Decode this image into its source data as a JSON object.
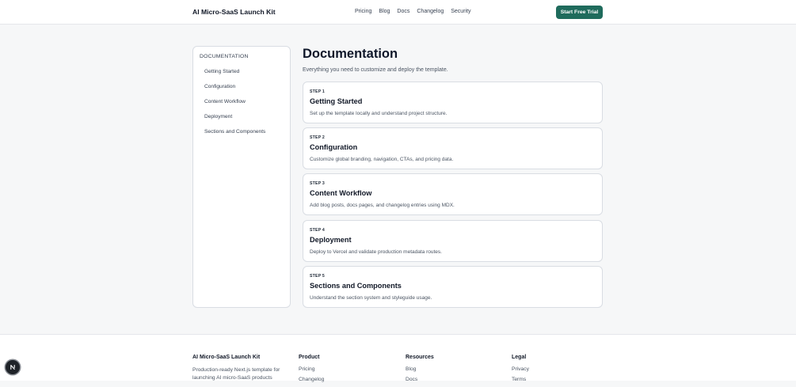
{
  "header": {
    "brand": "AI Micro-SaaS Launch Kit",
    "nav": [
      "Pricing",
      "Blog",
      "Docs",
      "Changelog",
      "Security"
    ],
    "cta": "Start Free Trial"
  },
  "sidebar": {
    "title": "DOCUMENTATION",
    "items": [
      "Getting Started",
      "Configuration",
      "Content Workflow",
      "Deployment",
      "Sections and Components"
    ]
  },
  "main": {
    "title": "Documentation",
    "subtitle": "Everything you need to customize and deploy the template.",
    "cards": [
      {
        "step": "STEP 1",
        "title": "Getting Started",
        "desc": "Set up the template locally and understand project structure."
      },
      {
        "step": "STEP 2",
        "title": "Configuration",
        "desc": "Customize global branding, navigation, CTAs, and pricing data."
      },
      {
        "step": "STEP 3",
        "title": "Content Workflow",
        "desc": "Add blog posts, docs pages, and changelog entries using MDX."
      },
      {
        "step": "STEP 4",
        "title": "Deployment",
        "desc": "Deploy to Vercel and validate production metadata routes."
      },
      {
        "step": "STEP 5",
        "title": "Sections and Components",
        "desc": "Understand the section system and styleguide usage."
      }
    ]
  },
  "footer": {
    "brand": "AI Micro-SaaS Launch Kit",
    "tagline": "Production-ready Next.js template for launching AI micro-SaaS products",
    "product": {
      "title": "Product",
      "links": [
        "Pricing",
        "Changelog"
      ]
    },
    "resources": {
      "title": "Resources",
      "links": [
        "Blog",
        "Docs"
      ]
    },
    "legal": {
      "title": "Legal",
      "links": [
        "Privacy",
        "Terms"
      ]
    }
  },
  "colors": {
    "accent": "#1f6b5c",
    "background": "#f6f7f8"
  },
  "icons": {
    "fab": "nextjs-n-icon"
  }
}
